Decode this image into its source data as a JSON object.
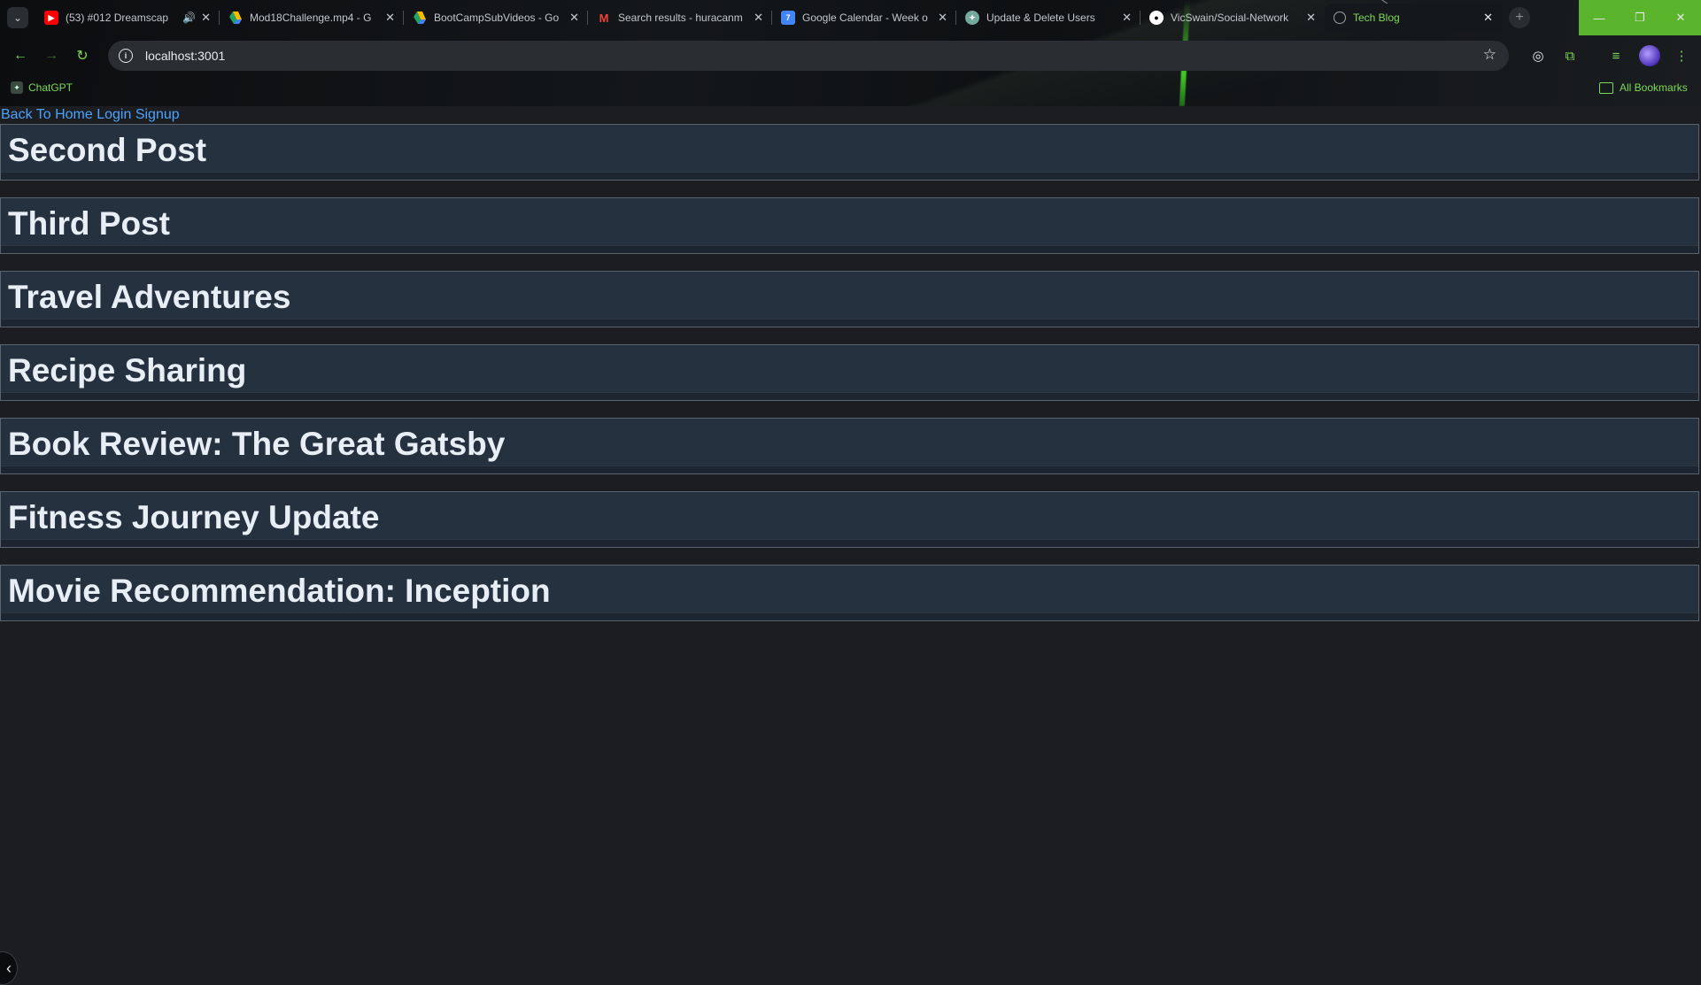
{
  "browser": {
    "tabs": [
      {
        "title": "(53) #012 Dreamscap",
        "favicon": "youtube-icon",
        "color": "#ff0000",
        "audio": true
      },
      {
        "title": "Mod18Challenge.mp4 - G",
        "favicon": "google-drive-icon",
        "color": "#1fa463"
      },
      {
        "title": "BootCampSubVideos - Go",
        "favicon": "google-drive-icon",
        "color": "#1fa463"
      },
      {
        "title": "Search results - huracanm",
        "favicon": "gmail-icon",
        "color": "#ea4335"
      },
      {
        "title": "Google Calendar - Week o",
        "favicon": "google-calendar-icon",
        "color": "#4285f4"
      },
      {
        "title": "Update & Delete Users",
        "favicon": "chatgpt-icon",
        "color": "#74aa9c"
      },
      {
        "title": "VicSwain/Social-Network",
        "favicon": "github-icon",
        "color": "#ffffff"
      },
      {
        "title": "Tech Blog",
        "favicon": "globe-icon",
        "color": "#9aa0a6",
        "active": true
      }
    ],
    "url": "localhost:3001",
    "bookmarks": [
      {
        "label": "ChatGPT",
        "icon": "chatgpt-icon"
      }
    ],
    "all_bookmarks_label": "All Bookmarks",
    "accent_color": "#7ed957"
  },
  "page": {
    "nav": {
      "home": "Back To Home",
      "login": "Login",
      "signup": "Signup"
    },
    "posts": [
      {
        "title": "Second Post"
      },
      {
        "title": "Third Post"
      },
      {
        "title": "Travel Adventures"
      },
      {
        "title": "Recipe Sharing"
      },
      {
        "title": "Book Review: The Great Gatsby"
      },
      {
        "title": "Fitness Journey Update"
      },
      {
        "title": "Movie Recommendation: Inception"
      }
    ]
  }
}
